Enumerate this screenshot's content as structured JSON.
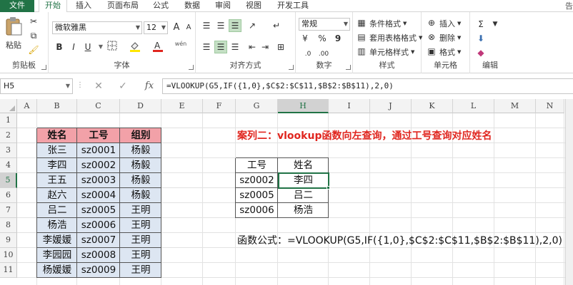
{
  "ribbon_tabs": [
    "文件",
    "开始",
    "插入",
    "页面布局",
    "公式",
    "数据",
    "审阅",
    "视图",
    "开发工具"
  ],
  "search_hint": "告",
  "clipboard": {
    "paste": "粘贴",
    "label": "剪贴板"
  },
  "font": {
    "name": "微软雅黑",
    "size": "12",
    "label": "字体",
    "bold": "B",
    "italic": "I",
    "underline": "U",
    "grow": "A",
    "shrink": "A",
    "color_letter": "A",
    "wen": "wén"
  },
  "alignment": {
    "label": "对齐方式"
  },
  "number": {
    "format": "常规",
    "label": "数字",
    "percent": "%",
    "comma": "9"
  },
  "styles": {
    "conditional": "条件格式",
    "table": "套用表格格式",
    "cell": "单元格样式",
    "label": "样式"
  },
  "cells": {
    "insert": "插入",
    "delete": "删除",
    "format": "格式",
    "label": "单元格"
  },
  "editing": {
    "sigma": "Σ",
    "label": "编辑"
  },
  "formula_bar": {
    "name_box": "H5",
    "fx": "fx",
    "formula": "=VLOOKUP(G5,IF({1,0},$C$2:$C$11,$B$2:$B$11),2,0)"
  },
  "columns": [
    "A",
    "B",
    "C",
    "D",
    "E",
    "F",
    "G",
    "H",
    "I",
    "J",
    "K",
    "L",
    "M",
    "N"
  ],
  "rows": [
    "1",
    "2",
    "3",
    "4",
    "5",
    "6",
    "7",
    "8",
    "9",
    "10",
    "11"
  ],
  "source_table": {
    "headers": [
      "姓名",
      "工号",
      "组别"
    ],
    "rows": [
      [
        "张三",
        "sz0001",
        "杨毅"
      ],
      [
        "李四",
        "sz0002",
        "杨毅"
      ],
      [
        "王五",
        "sz0003",
        "杨毅"
      ],
      [
        "赵六",
        "sz0004",
        "杨毅"
      ],
      [
        "吕二",
        "sz0005",
        "王明"
      ],
      [
        "杨浩",
        "sz0006",
        "王明"
      ],
      [
        "李媛媛",
        "sz0007",
        "王明"
      ],
      [
        "李园园",
        "sz0008",
        "王明"
      ],
      [
        "杨媛媛",
        "sz0009",
        "王明"
      ]
    ]
  },
  "case_title": "案列二：vlookup函数向左查询，通过工号查询对应姓名",
  "lookup_table": {
    "headers": [
      "工号",
      "姓名"
    ],
    "rows": [
      [
        "sz0002",
        "李四"
      ],
      [
        "sz0005",
        "吕二"
      ],
      [
        "sz0006",
        "杨浩"
      ]
    ]
  },
  "formula_note": "函数公式：=VLOOKUP(G5,IF({1,0},$C$2:$C$11,$B$2:$B$11),2,0)",
  "colors": {
    "excel_green": "#217346",
    "header_red": "#f2a1a8",
    "row_blue": "#dde6f2",
    "title_red": "#e0261f"
  }
}
